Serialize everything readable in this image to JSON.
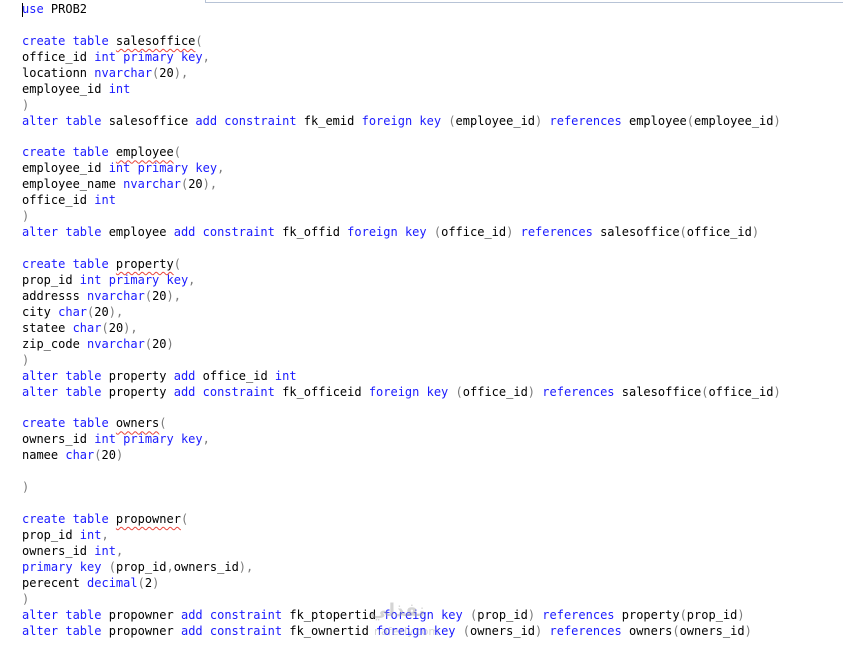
{
  "editor": {
    "language": "sql",
    "lines": [
      [
        {
          "t": "kw",
          "v": "use"
        },
        {
          "t": "id",
          "v": " PROB2"
        }
      ],
      [],
      [
        {
          "t": "kw",
          "v": "create table "
        },
        {
          "t": "err",
          "v": "salesoffice"
        },
        {
          "t": "pun",
          "v": "("
        }
      ],
      [
        {
          "t": "id",
          "v": "office_id "
        },
        {
          "t": "kw",
          "v": "int primary key"
        },
        {
          "t": "pun",
          "v": ","
        }
      ],
      [
        {
          "t": "id",
          "v": "locationn "
        },
        {
          "t": "kw",
          "v": "nvarchar"
        },
        {
          "t": "pun",
          "v": "("
        },
        {
          "t": "num",
          "v": "20"
        },
        {
          "t": "pun",
          "v": "),"
        }
      ],
      [
        {
          "t": "id",
          "v": "employee_id "
        },
        {
          "t": "kw",
          "v": "int"
        }
      ],
      [
        {
          "t": "pun",
          "v": ")"
        }
      ],
      [
        {
          "t": "kw",
          "v": "alter table"
        },
        {
          "t": "id",
          "v": " salesoffice "
        },
        {
          "t": "kw",
          "v": "add constraint"
        },
        {
          "t": "id",
          "v": " fk_emid "
        },
        {
          "t": "kw",
          "v": "foreign key"
        },
        {
          "t": "id",
          "v": " "
        },
        {
          "t": "pun",
          "v": "("
        },
        {
          "t": "id",
          "v": "employee_id"
        },
        {
          "t": "pun",
          "v": ")"
        },
        {
          "t": "id",
          "v": " "
        },
        {
          "t": "kw",
          "v": "references"
        },
        {
          "t": "id",
          "v": " employee"
        },
        {
          "t": "pun",
          "v": "("
        },
        {
          "t": "id",
          "v": "employee_id"
        },
        {
          "t": "pun",
          "v": ")"
        }
      ],
      [],
      [
        {
          "t": "kw",
          "v": "create table "
        },
        {
          "t": "err",
          "v": "employee"
        },
        {
          "t": "pun",
          "v": "("
        }
      ],
      [
        {
          "t": "id",
          "v": "employee_id "
        },
        {
          "t": "kw",
          "v": "int primary key"
        },
        {
          "t": "pun",
          "v": ","
        }
      ],
      [
        {
          "t": "id",
          "v": "employee_name "
        },
        {
          "t": "kw",
          "v": "nvarchar"
        },
        {
          "t": "pun",
          "v": "("
        },
        {
          "t": "num",
          "v": "20"
        },
        {
          "t": "pun",
          "v": "),"
        }
      ],
      [
        {
          "t": "id",
          "v": "office_id "
        },
        {
          "t": "kw",
          "v": "int"
        }
      ],
      [
        {
          "t": "pun",
          "v": ")"
        }
      ],
      [
        {
          "t": "kw",
          "v": "alter table"
        },
        {
          "t": "id",
          "v": " employee "
        },
        {
          "t": "kw",
          "v": "add constraint"
        },
        {
          "t": "id",
          "v": " fk_offid "
        },
        {
          "t": "kw",
          "v": "foreign key"
        },
        {
          "t": "id",
          "v": " "
        },
        {
          "t": "pun",
          "v": "("
        },
        {
          "t": "id",
          "v": "office_id"
        },
        {
          "t": "pun",
          "v": ")"
        },
        {
          "t": "id",
          "v": " "
        },
        {
          "t": "kw",
          "v": "references"
        },
        {
          "t": "id",
          "v": " salesoffice"
        },
        {
          "t": "pun",
          "v": "("
        },
        {
          "t": "id",
          "v": "office_id"
        },
        {
          "t": "pun",
          "v": ")"
        }
      ],
      [],
      [
        {
          "t": "kw",
          "v": "create table "
        },
        {
          "t": "err",
          "v": "property"
        },
        {
          "t": "pun",
          "v": "("
        }
      ],
      [
        {
          "t": "id",
          "v": "prop_id "
        },
        {
          "t": "kw",
          "v": "int primary key"
        },
        {
          "t": "pun",
          "v": ","
        }
      ],
      [
        {
          "t": "id",
          "v": "addresss "
        },
        {
          "t": "kw",
          "v": "nvarchar"
        },
        {
          "t": "pun",
          "v": "("
        },
        {
          "t": "num",
          "v": "20"
        },
        {
          "t": "pun",
          "v": "),"
        }
      ],
      [
        {
          "t": "id",
          "v": "city "
        },
        {
          "t": "kw",
          "v": "char"
        },
        {
          "t": "pun",
          "v": "("
        },
        {
          "t": "num",
          "v": "20"
        },
        {
          "t": "pun",
          "v": "),"
        }
      ],
      [
        {
          "t": "id",
          "v": "statee "
        },
        {
          "t": "kw",
          "v": "char"
        },
        {
          "t": "pun",
          "v": "("
        },
        {
          "t": "num",
          "v": "20"
        },
        {
          "t": "pun",
          "v": "),"
        }
      ],
      [
        {
          "t": "id",
          "v": "zip_code "
        },
        {
          "t": "kw",
          "v": "nvarchar"
        },
        {
          "t": "pun",
          "v": "("
        },
        {
          "t": "num",
          "v": "20"
        },
        {
          "t": "pun",
          "v": ")"
        }
      ],
      [
        {
          "t": "pun",
          "v": ")"
        }
      ],
      [
        {
          "t": "kw",
          "v": "alter table"
        },
        {
          "t": "id",
          "v": " property "
        },
        {
          "t": "kw",
          "v": "add"
        },
        {
          "t": "id",
          "v": " office_id "
        },
        {
          "t": "kw",
          "v": "int"
        }
      ],
      [
        {
          "t": "kw",
          "v": "alter table"
        },
        {
          "t": "id",
          "v": " property "
        },
        {
          "t": "kw",
          "v": "add constraint"
        },
        {
          "t": "id",
          "v": " fk_officeid "
        },
        {
          "t": "kw",
          "v": "foreign key"
        },
        {
          "t": "id",
          "v": " "
        },
        {
          "t": "pun",
          "v": "("
        },
        {
          "t": "id",
          "v": "office_id"
        },
        {
          "t": "pun",
          "v": ")"
        },
        {
          "t": "id",
          "v": " "
        },
        {
          "t": "kw",
          "v": "references"
        },
        {
          "t": "id",
          "v": " salesoffice"
        },
        {
          "t": "pun",
          "v": "("
        },
        {
          "t": "id",
          "v": "office_id"
        },
        {
          "t": "pun",
          "v": ")"
        }
      ],
      [],
      [
        {
          "t": "kw",
          "v": "create table "
        },
        {
          "t": "err",
          "v": "owners"
        },
        {
          "t": "pun",
          "v": "("
        }
      ],
      [
        {
          "t": "id",
          "v": "owners_id "
        },
        {
          "t": "kw",
          "v": "int primary key"
        },
        {
          "t": "pun",
          "v": ","
        }
      ],
      [
        {
          "t": "id",
          "v": "namee "
        },
        {
          "t": "kw",
          "v": "char"
        },
        {
          "t": "pun",
          "v": "("
        },
        {
          "t": "num",
          "v": "20"
        },
        {
          "t": "pun",
          "v": ")"
        }
      ],
      [],
      [
        {
          "t": "pun",
          "v": ")"
        }
      ],
      [],
      [
        {
          "t": "kw",
          "v": "create table "
        },
        {
          "t": "err",
          "v": "propowner"
        },
        {
          "t": "pun",
          "v": "("
        }
      ],
      [
        {
          "t": "id",
          "v": "prop_id "
        },
        {
          "t": "kw",
          "v": "int"
        },
        {
          "t": "pun",
          "v": ","
        }
      ],
      [
        {
          "t": "id",
          "v": "owners_id "
        },
        {
          "t": "kw",
          "v": "int"
        },
        {
          "t": "pun",
          "v": ","
        }
      ],
      [
        {
          "t": "kw",
          "v": "primary key"
        },
        {
          "t": "id",
          "v": " "
        },
        {
          "t": "pun",
          "v": "("
        },
        {
          "t": "id",
          "v": "prop_id"
        },
        {
          "t": "pun",
          "v": ","
        },
        {
          "t": "id",
          "v": "owners_id"
        },
        {
          "t": "pun",
          "v": "),"
        }
      ],
      [
        {
          "t": "id",
          "v": "perecent "
        },
        {
          "t": "kw",
          "v": "decimal"
        },
        {
          "t": "pun",
          "v": "("
        },
        {
          "t": "num",
          "v": "2"
        },
        {
          "t": "pun",
          "v": ")"
        }
      ],
      [
        {
          "t": "pun",
          "v": ")"
        }
      ],
      [
        {
          "t": "kw",
          "v": "alter table"
        },
        {
          "t": "id",
          "v": " propowner "
        },
        {
          "t": "kw",
          "v": "add constraint"
        },
        {
          "t": "id",
          "v": " fk_ptopertid "
        },
        {
          "t": "kw",
          "v": "foreign key"
        },
        {
          "t": "id",
          "v": " "
        },
        {
          "t": "pun",
          "v": "("
        },
        {
          "t": "id",
          "v": "prop_id"
        },
        {
          "t": "pun",
          "v": ")"
        },
        {
          "t": "id",
          "v": " "
        },
        {
          "t": "kw",
          "v": "references"
        },
        {
          "t": "id",
          "v": " property"
        },
        {
          "t": "pun",
          "v": "("
        },
        {
          "t": "id",
          "v": "prop_id"
        },
        {
          "t": "pun",
          "v": ")"
        }
      ],
      [
        {
          "t": "kw",
          "v": "alter table"
        },
        {
          "t": "id",
          "v": " propowner "
        },
        {
          "t": "kw",
          "v": "add constraint"
        },
        {
          "t": "id",
          "v": " fk_ownertid "
        },
        {
          "t": "kw",
          "v": "foreign key"
        },
        {
          "t": "id",
          "v": " "
        },
        {
          "t": "pun",
          "v": "("
        },
        {
          "t": "id",
          "v": "owners_id"
        },
        {
          "t": "pun",
          "v": ")"
        },
        {
          "t": "id",
          "v": " "
        },
        {
          "t": "kw",
          "v": "references"
        },
        {
          "t": "id",
          "v": " owners"
        },
        {
          "t": "pun",
          "v": "("
        },
        {
          "t": "id",
          "v": "owners_id"
        },
        {
          "t": "pun",
          "v": ")"
        }
      ]
    ]
  },
  "watermark": {
    "main": "نفذلي",
    "sub": "nafezly.com"
  },
  "colors": {
    "keyword": "#1a1aff",
    "identifier": "#000000",
    "punctuation": "#7a7a7a",
    "squiggle": "#e8453c",
    "background": "#ffffff"
  }
}
